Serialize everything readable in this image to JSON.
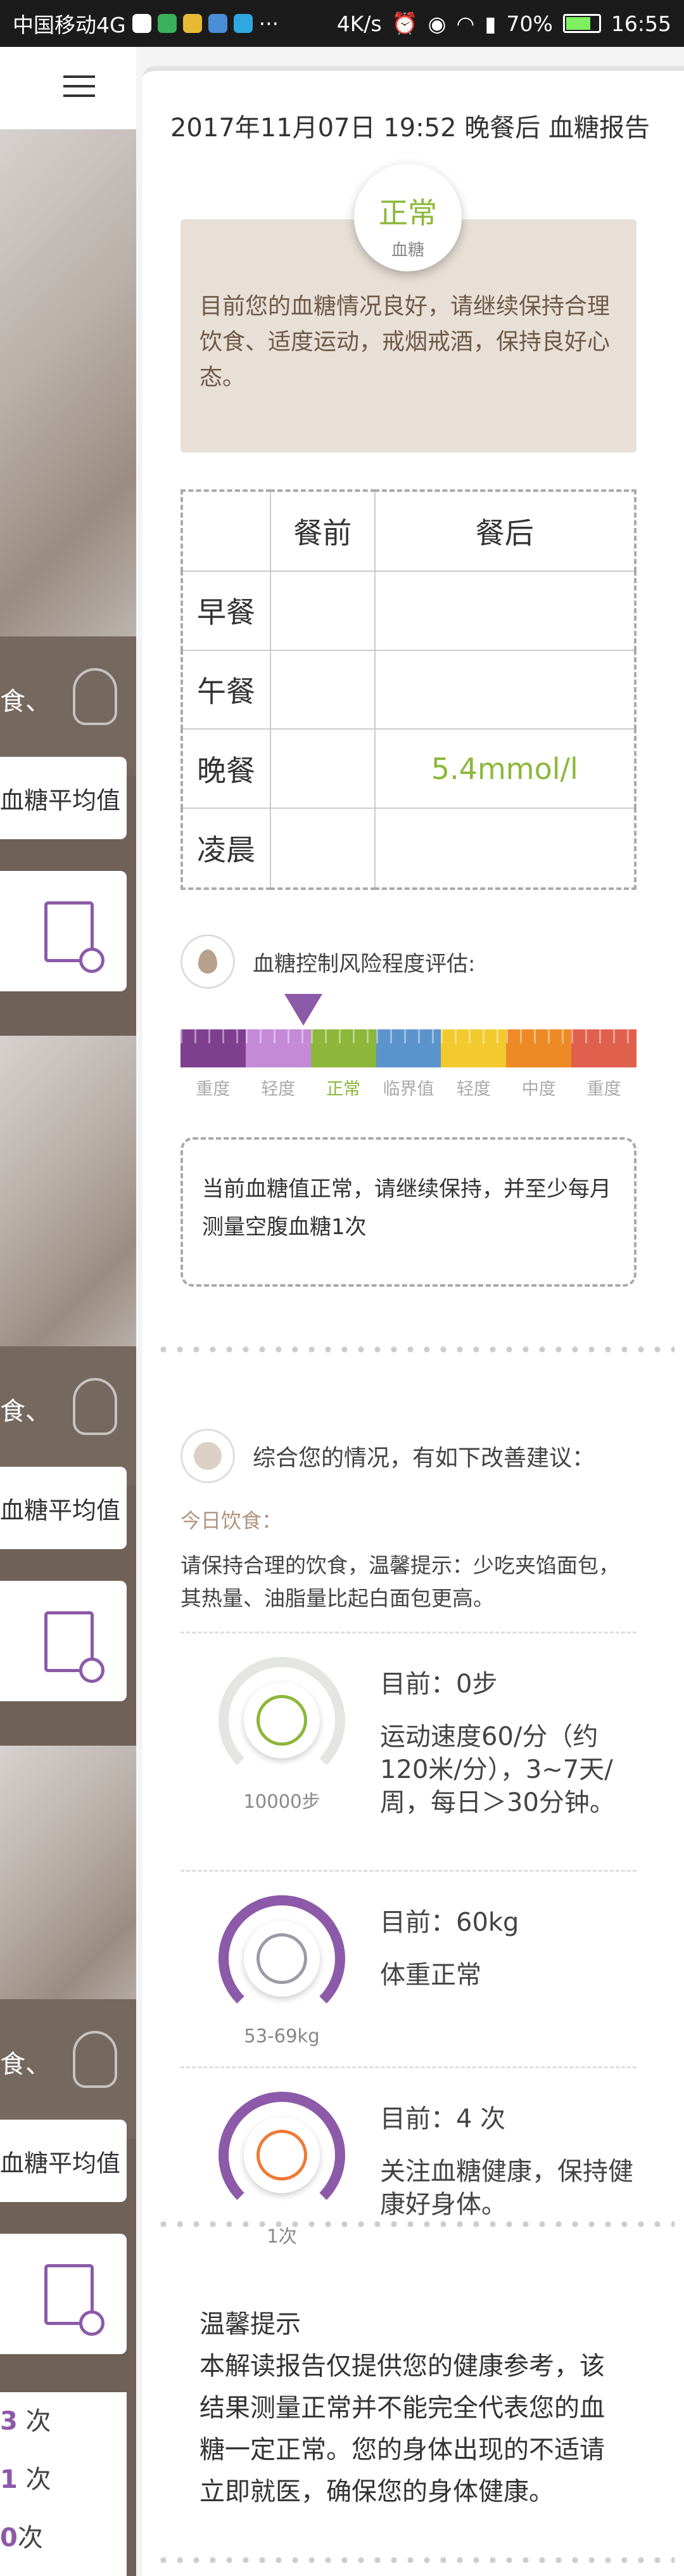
{
  "statusbar": {
    "carrier": "中国移动4G",
    "speed": "4K/s",
    "battery": "70%",
    "time": "16:55"
  },
  "background": {
    "band_text": "食、",
    "avg_label": "血糖平均值",
    "counts": [
      {
        "num": "3",
        "unit": " 次"
      },
      {
        "num": "1",
        "unit": " 次"
      },
      {
        "num": "0",
        "unit": "次"
      }
    ]
  },
  "report": {
    "title": "2017年11月07日 19:52 晚餐后 血糖报告",
    "status": {
      "value": "正常",
      "label": "血糖",
      "message": "目前您的血糖情况良好，请继续保持合理饮食、适度运动，戒烟戒酒，保持良好心态。"
    },
    "table": {
      "headers": [
        "",
        "餐前",
        "餐后"
      ],
      "rows": [
        {
          "label": "早餐",
          "before": "",
          "after": ""
        },
        {
          "label": "午餐",
          "before": "",
          "after": ""
        },
        {
          "label": "晚餐",
          "before": "",
          "after": "5.4mmol/l"
        },
        {
          "label": "凌晨",
          "before": "",
          "after": ""
        }
      ]
    },
    "risk": {
      "heading": "血糖控制风险程度评估:",
      "current_index": 2,
      "levels": [
        {
          "label": "重度",
          "color": "#7f3f8f"
        },
        {
          "label": "轻度",
          "color": "#c48ad8"
        },
        {
          "label": "正常",
          "color": "#8cb73a"
        },
        {
          "label": "临界值",
          "color": "#5b94cc"
        },
        {
          "label": "轻度",
          "color": "#f2ca2d"
        },
        {
          "label": "中度",
          "color": "#ee8a25"
        },
        {
          "label": "重度",
          "color": "#e0604e"
        }
      ],
      "advice": "当前血糖值正常，请继续保持，并至少每月测量空腹血糖1次"
    },
    "suggestions": {
      "heading": "综合您的情况，有如下改善建议：",
      "diet_title": "今日饮食：",
      "diet_text": "请保持合理的饮食，温馨提示：少吃夹馅面包，其热量、油脂量比起白面包更高。",
      "items": [
        {
          "icon": "running-icon",
          "caption": "10000步",
          "current": "目前：0步",
          "text": "运动速度60/分（约120米/分），3~7天/周，每日＞30分钟。",
          "ring_color": "#e4e6e3",
          "icon_color": "#8cb73a"
        },
        {
          "icon": "scale-icon",
          "caption": "53-69kg",
          "current": "目前：60kg",
          "text": "体重正常",
          "ring_color": "#8c5aa8",
          "icon_color": "#9a9aa8"
        },
        {
          "icon": "blood-drop-icon",
          "caption": "1次",
          "current": "目前：4 次",
          "text": "关注血糖健康，保持健康好身体。",
          "ring_color": "#8c5aa8",
          "icon_color": "#ee7a35"
        }
      ]
    },
    "tip": {
      "title": "温馨提示",
      "text": "本解读报告仅提供您的健康参考，该结果测量正常并不能完全代表您的血糖一定正常。您的身体出现的不适请立即就医，确保您的身体健康。"
    }
  }
}
